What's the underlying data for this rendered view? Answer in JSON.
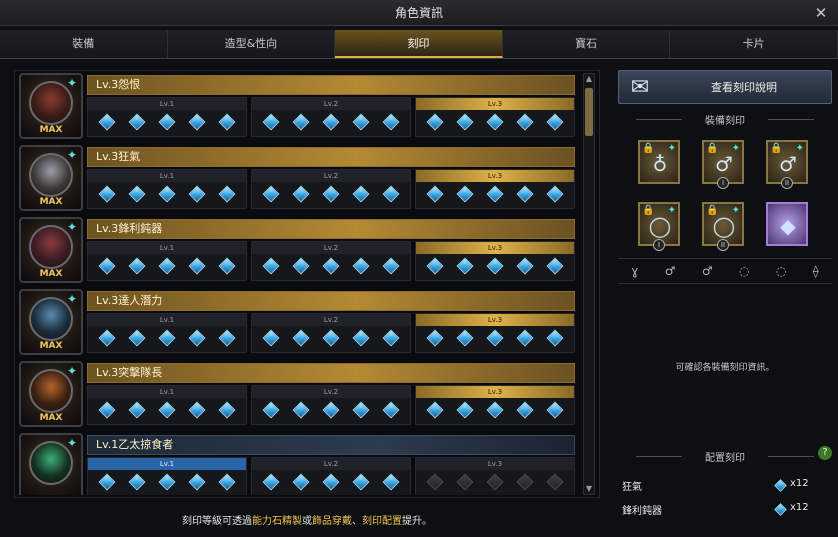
{
  "window": {
    "title": "角色資訊"
  },
  "tabs": [
    {
      "label": "裝備",
      "active": false
    },
    {
      "label": "造型&性向",
      "active": false
    },
    {
      "label": "刻印",
      "active": true
    },
    {
      "label": "寶石",
      "active": false
    },
    {
      "label": "卡片",
      "active": false
    }
  ],
  "engravings": [
    {
      "name": "Lv.3怨恨",
      "level": 3,
      "max": "MAX",
      "icon": "portrait-grudge",
      "level_labels": [
        "Lv.1",
        "Lv.2",
        "Lv.3"
      ],
      "active_gems": 15
    },
    {
      "name": "Lv.3狂氣",
      "level": 3,
      "max": "MAX",
      "icon": "portrait-rage",
      "level_labels": [
        "Lv.1",
        "Lv.2",
        "Lv.3"
      ],
      "active_gems": 15
    },
    {
      "name": "Lv.3鋒利鈍器",
      "level": 3,
      "max": "MAX",
      "icon": "portrait-keen-blunt",
      "level_labels": [
        "Lv.1",
        "Lv.2",
        "Lv.3"
      ],
      "active_gems": 15
    },
    {
      "name": "Lv.3達人潛力",
      "level": 3,
      "max": "MAX",
      "icon": "portrait-master",
      "level_labels": [
        "Lv.1",
        "Lv.2",
        "Lv.3"
      ],
      "active_gems": 15
    },
    {
      "name": "Lv.3突擊隊長",
      "level": 3,
      "max": "MAX",
      "icon": "portrait-raid",
      "level_labels": [
        "Lv.1",
        "Lv.2",
        "Lv.3"
      ],
      "active_gems": 15
    },
    {
      "name": "Lv.1乙太掠食者",
      "level": 1,
      "max": "",
      "icon": "portrait-ether",
      "level_labels": [
        "Lv.1",
        "Lv.2",
        "Lv.3"
      ],
      "active_gems": 10
    }
  ],
  "footer": {
    "p1": "刻印等級可透過",
    "h1": "能力石精製",
    "p2": "或",
    "h2": "飾品穿戴",
    "p3": "、",
    "h3": "刻印配置",
    "p4": "提升。"
  },
  "right": {
    "view_button": "查看刻印說明",
    "equip_title": "裝備刻印",
    "slots": [
      {
        "icon": "necklace-icon",
        "roman": "",
        "purple": false
      },
      {
        "icon": "earring-icon",
        "roman": "I",
        "purple": false
      },
      {
        "icon": "earring-icon",
        "roman": "II",
        "purple": false
      },
      {
        "icon": "ring-icon",
        "roman": "I",
        "purple": false
      },
      {
        "icon": "ring-icon",
        "roman": "II",
        "purple": false
      },
      {
        "icon": "stone-icon",
        "roman": "",
        "purple": true
      }
    ],
    "info_text": "可確認各裝備刻印資訊。",
    "config_title": "配置刻印",
    "config": [
      {
        "name": "狂氣",
        "count": "x12"
      },
      {
        "name": "鋒利鈍器",
        "count": "x12"
      }
    ]
  }
}
